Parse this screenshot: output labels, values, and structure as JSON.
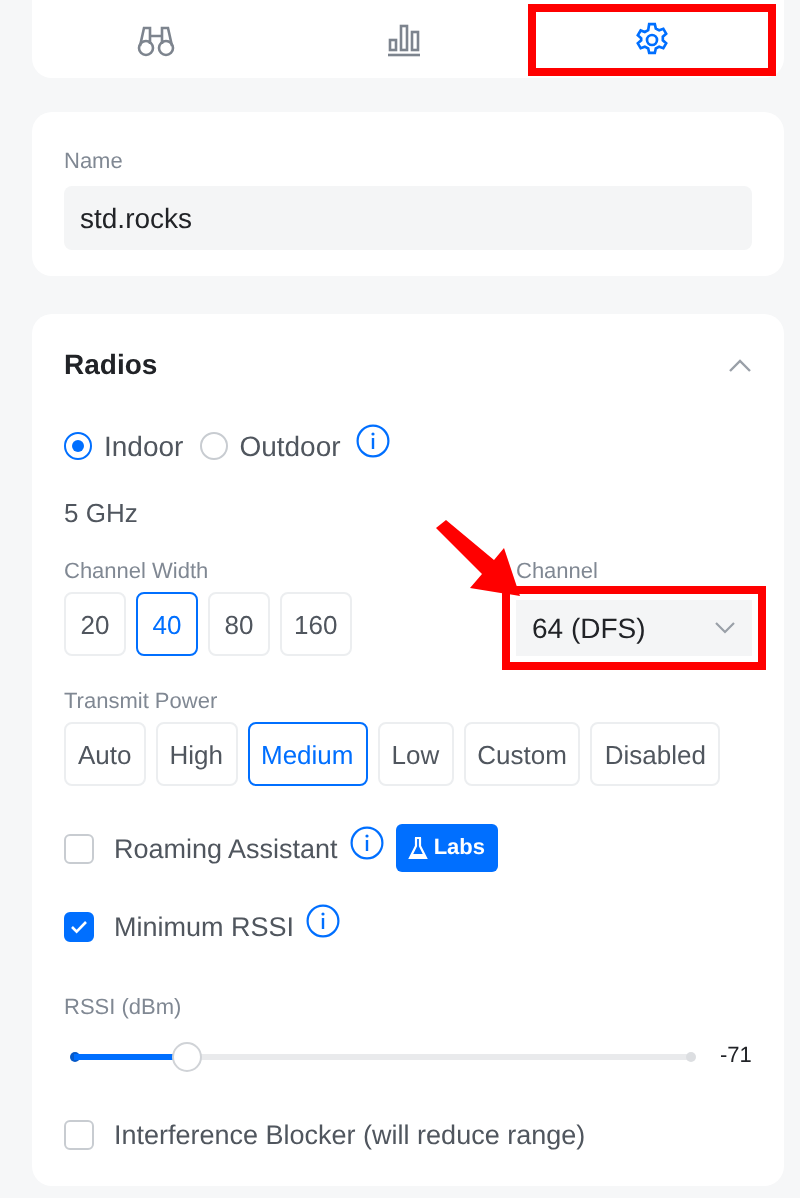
{
  "tabs": [
    {
      "kind": "binoculars",
      "selected": false,
      "highlighted": false
    },
    {
      "kind": "chart",
      "selected": false,
      "highlighted": false
    },
    {
      "kind": "gear",
      "selected": true,
      "highlighted": true
    }
  ],
  "name_field": {
    "label": "Name",
    "value": "std.rocks"
  },
  "radios": {
    "title": "Radios",
    "expanded": true,
    "placement": [
      {
        "label": "Indoor",
        "selected": true
      },
      {
        "label": "Outdoor",
        "selected": false,
        "info": true
      }
    ],
    "band": "5 GHz",
    "channel_width": {
      "label": "Channel Width",
      "options": [
        {
          "label": "20",
          "selected": false
        },
        {
          "label": "40",
          "selected": true
        },
        {
          "label": "80",
          "selected": false
        },
        {
          "label": "160",
          "selected": false
        }
      ]
    },
    "channel": {
      "label": "Channel",
      "value": "64 (DFS)",
      "highlighted": true,
      "pointed": true
    },
    "transmit_power": {
      "label": "Transmit Power",
      "options": [
        {
          "label": "Auto",
          "selected": false
        },
        {
          "label": "High",
          "selected": false
        },
        {
          "label": "Medium",
          "selected": true
        },
        {
          "label": "Low",
          "selected": false
        },
        {
          "label": "Custom",
          "selected": false
        },
        {
          "label": "Disabled",
          "selected": false
        }
      ]
    },
    "roaming_assistant": {
      "label": "Roaming Assistant",
      "checked": false,
      "badge": "Labs"
    },
    "minimum_rssi": {
      "label": "Minimum RSSI",
      "checked": true
    },
    "rssi": {
      "label": "RSSI (dBm)",
      "level": 0.18,
      "reading": "-71"
    },
    "interference_blocker": {
      "label": "Interference Blocker (will reduce range)",
      "checked": false
    }
  }
}
